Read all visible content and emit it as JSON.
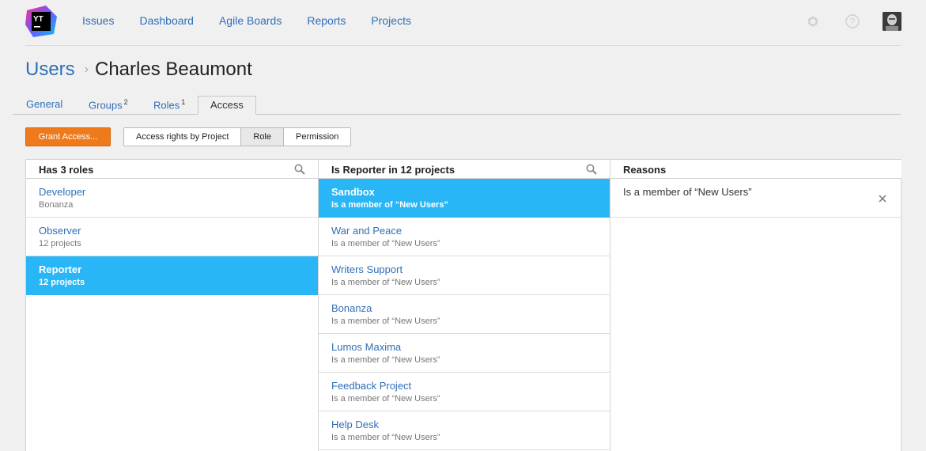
{
  "logo": {
    "text": "YT"
  },
  "nav": [
    "Issues",
    "Dashboard",
    "Agile Boards",
    "Reports",
    "Projects"
  ],
  "header_icons": [
    "gear-icon",
    "help-icon",
    "avatar"
  ],
  "breadcrumb": {
    "parent": "Users",
    "separator": "›",
    "current": "Charles Beaumont"
  },
  "tabs": [
    {
      "label": "General",
      "count": ""
    },
    {
      "label": "Groups",
      "count": "2"
    },
    {
      "label": "Roles",
      "count": "1"
    },
    {
      "label": "Access",
      "count": ""
    }
  ],
  "toolbar": {
    "grant_label": "Grant Access...",
    "segments": [
      "Access rights by Project",
      "Role",
      "Permission"
    ],
    "active_segment": "Role"
  },
  "roles_column": {
    "header": "Has 3 roles",
    "items": [
      {
        "title": "Developer",
        "subtitle": "Bonanza"
      },
      {
        "title": "Observer",
        "subtitle": "12 projects"
      },
      {
        "title": "Reporter",
        "subtitle": "12 projects",
        "selected": true
      }
    ]
  },
  "projects_column": {
    "header": "Is Reporter in 12 projects",
    "items": [
      {
        "title": "Sandbox",
        "subtitle": "Is a member of “New Users”",
        "selected": true
      },
      {
        "title": "War and Peace",
        "subtitle": "Is a member of “New Users”"
      },
      {
        "title": "Writers Support",
        "subtitle": "Is a member of “New Users”"
      },
      {
        "title": "Bonanza",
        "subtitle": "Is a member of “New Users”"
      },
      {
        "title": "Lumos Maxima",
        "subtitle": "Is a member of “New Users”"
      },
      {
        "title": "Feedback Project",
        "subtitle": "Is a member of “New Users”"
      },
      {
        "title": "Help Desk",
        "subtitle": "Is a member of “New Users”"
      }
    ]
  },
  "reasons_column": {
    "header": "Reasons",
    "items": [
      {
        "text": "Is a member of “New Users”"
      }
    ]
  },
  "colors": {
    "accent": "#29b6f6",
    "link": "#2f6fb8",
    "grant": "#ef7a1b"
  }
}
